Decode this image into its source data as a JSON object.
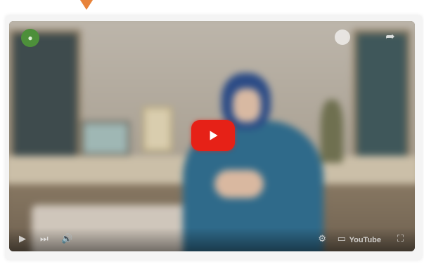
{
  "player": {
    "channel_icon": "channel-logo-icon",
    "title": "",
    "play_button_icon": "youtube-play-icon",
    "controls": {
      "play_icon": "play-icon",
      "next_icon": "next-icon",
      "volume_icon": "volume-icon",
      "settings_icon": "settings-gear-icon",
      "cc_icon": "captions-icon",
      "brand_label": "YouTube",
      "fullscreen_icon": "fullscreen-icon"
    }
  },
  "colors": {
    "accent_pointer": "#e8833a",
    "youtube_red": "#e62117"
  }
}
